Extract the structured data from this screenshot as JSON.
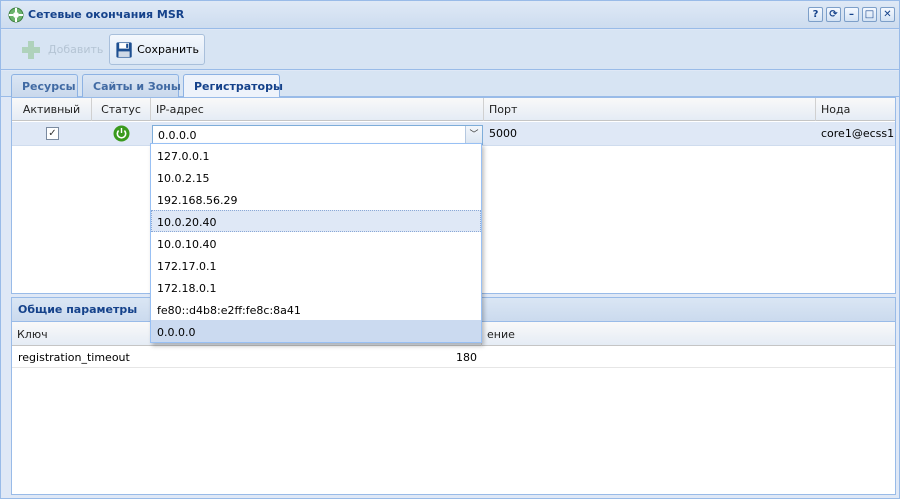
{
  "window": {
    "title": "Сетевые окончания MSR",
    "tools": [
      "?",
      "⟳",
      "–",
      "□",
      "✕"
    ]
  },
  "toolbar": {
    "add_label": "Добавить",
    "save_label": "Сохранить"
  },
  "tabs": [
    {
      "label": "Ресурсы"
    },
    {
      "label": "Сайты и Зоны"
    },
    {
      "label": "Регистраторы"
    }
  ],
  "grid": {
    "columns": [
      "Активный",
      "Статус",
      "IP-адрес",
      "Порт",
      "Нода"
    ],
    "rows": [
      {
        "active": "✓",
        "ip": "0.0.0.0",
        "port": "5000",
        "node": "core1@ecss1"
      }
    ]
  },
  "dropdown": {
    "options": [
      "127.0.0.1",
      "10.0.2.15",
      "192.168.56.29",
      "10.0.20.40",
      "10.0.10.40",
      "172.17.0.1",
      "172.18.0.1",
      "fe80::d4b8:e2ff:fe8c:8a41",
      "0.0.0.0"
    ],
    "hovered": "10.0.20.40",
    "selected": "0.0.0.0"
  },
  "params": {
    "title": "Общие параметры",
    "columns": [
      "Ключ",
      "ение"
    ],
    "rows": [
      {
        "key": "registration_timeout",
        "value": "180"
      }
    ]
  },
  "colors": {
    "accent": "#15428b",
    "status_ok": "#3a9a1e"
  }
}
